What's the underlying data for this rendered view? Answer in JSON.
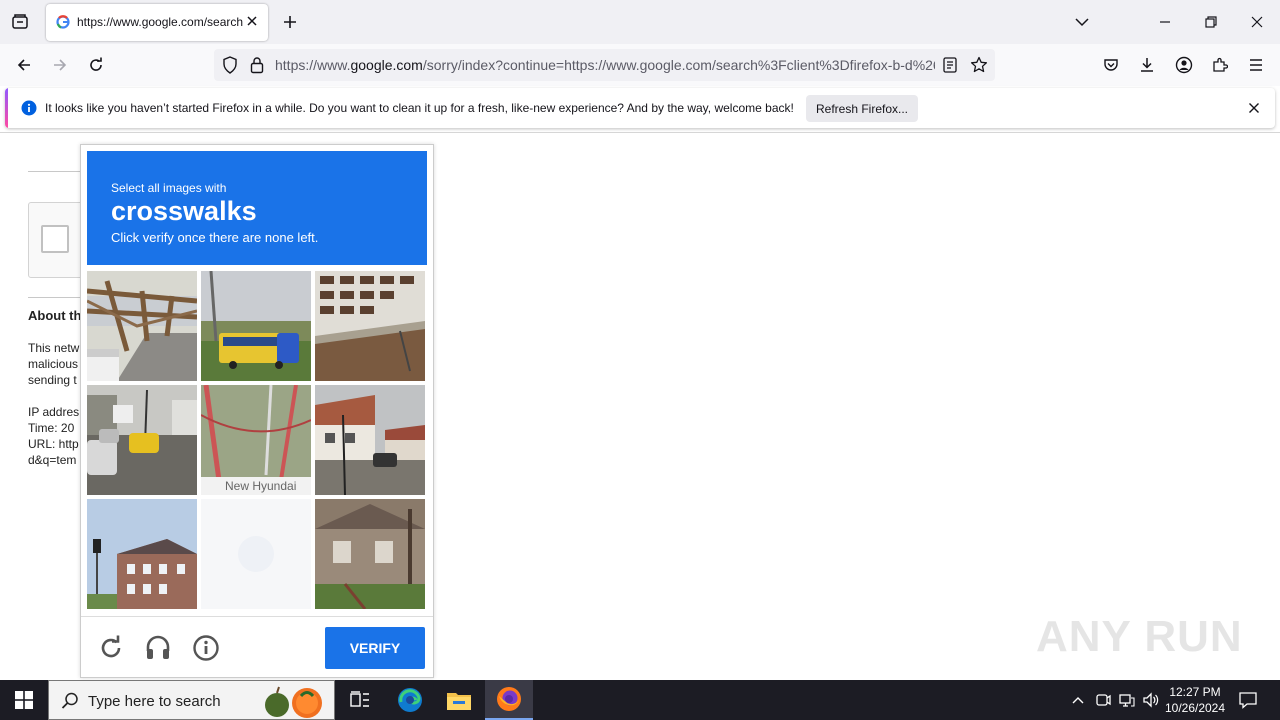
{
  "browser": {
    "tab_title": "https://www.google.com/search",
    "url_prefix": "https://www.",
    "url_host": "google.com",
    "url_rest": "/sorry/index?continue=https://www.google.com/search%3Fclient%3Dfirefox-b-d%26",
    "notification_text": "It looks like you haven’t started Firefox in a while. Do you want to clean it up for a fresh, like-new experience? And by the way, welcome back!",
    "refresh_button": "Refresh Firefox..."
  },
  "page": {
    "about_heading": "About th",
    "body_lines": [
      "This netw",
      "malicious",
      "sending t"
    ],
    "info_lines": [
      "IP addres",
      "Time: 20",
      "URL: http",
      "d&q=tem"
    ]
  },
  "captcha": {
    "instruction_line1": "Select all images with",
    "target": "crosswalks",
    "instruction_line3": "Click verify once there are none left.",
    "tile_caption": "New Hyundai",
    "verify_label": "VERIFY",
    "icons": [
      "reload-icon",
      "audio-icon",
      "info-icon"
    ]
  },
  "taskbar": {
    "search_placeholder": "Type here to search",
    "time": "12:27 PM",
    "date": "10/26/2024"
  },
  "watermark": "ANY RUN",
  "colors": {
    "accent": "#1a73e8",
    "taskbar": "#1c1c24",
    "tab_bg": "#f0f0f4"
  }
}
